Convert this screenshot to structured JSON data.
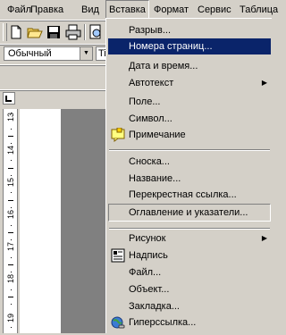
{
  "menubar": {
    "items": [
      "Файл",
      "Правка",
      "Вид",
      "Вставка",
      "Формат",
      "Сервис",
      "Таблица"
    ],
    "open_item": "Вставка"
  },
  "toolbar": {
    "style_value": "Обычный",
    "font_value": "Ti"
  },
  "ruler": {
    "numbers": [
      "13",
      "14",
      "15",
      "16",
      "17",
      "18",
      "19"
    ]
  },
  "insert_menu": {
    "items": [
      {
        "label": "Разрыв...",
        "icon": null,
        "submenu": false
      },
      {
        "label": "Номера страниц...",
        "icon": null,
        "submenu": false,
        "highlighted": true
      },
      {
        "label": "Дата и время...",
        "icon": null,
        "submenu": false
      },
      {
        "label": "Автотекст",
        "icon": null,
        "submenu": true
      },
      {
        "label": "Поле...",
        "icon": null,
        "submenu": false
      },
      {
        "label": "Символ...",
        "icon": null,
        "submenu": false
      },
      {
        "label": "Примечание",
        "icon": "comment-icon",
        "submenu": false
      },
      {
        "label": "Сноска...",
        "icon": null,
        "submenu": false
      },
      {
        "label": "Название...",
        "icon": null,
        "submenu": false
      },
      {
        "label": "Перекрестная ссылка...",
        "icon": null,
        "submenu": false
      },
      {
        "label": "Оглавление и указатели...",
        "icon": null,
        "submenu": false,
        "boxed": true
      },
      {
        "label": "Рисунок",
        "icon": null,
        "submenu": true
      },
      {
        "label": "Надпись",
        "icon": "textbox-icon",
        "submenu": false
      },
      {
        "label": "Файл...",
        "icon": null,
        "submenu": false
      },
      {
        "label": "Объект...",
        "icon": null,
        "submenu": false
      },
      {
        "label": "Закладка...",
        "icon": null,
        "submenu": false
      },
      {
        "label": "Гиперссылка...",
        "icon": "hyperlink-icon",
        "submenu": false
      }
    ]
  },
  "colors": {
    "face": "#d4d0c8",
    "highlight": "#0a246a",
    "shadow": "#808080"
  }
}
